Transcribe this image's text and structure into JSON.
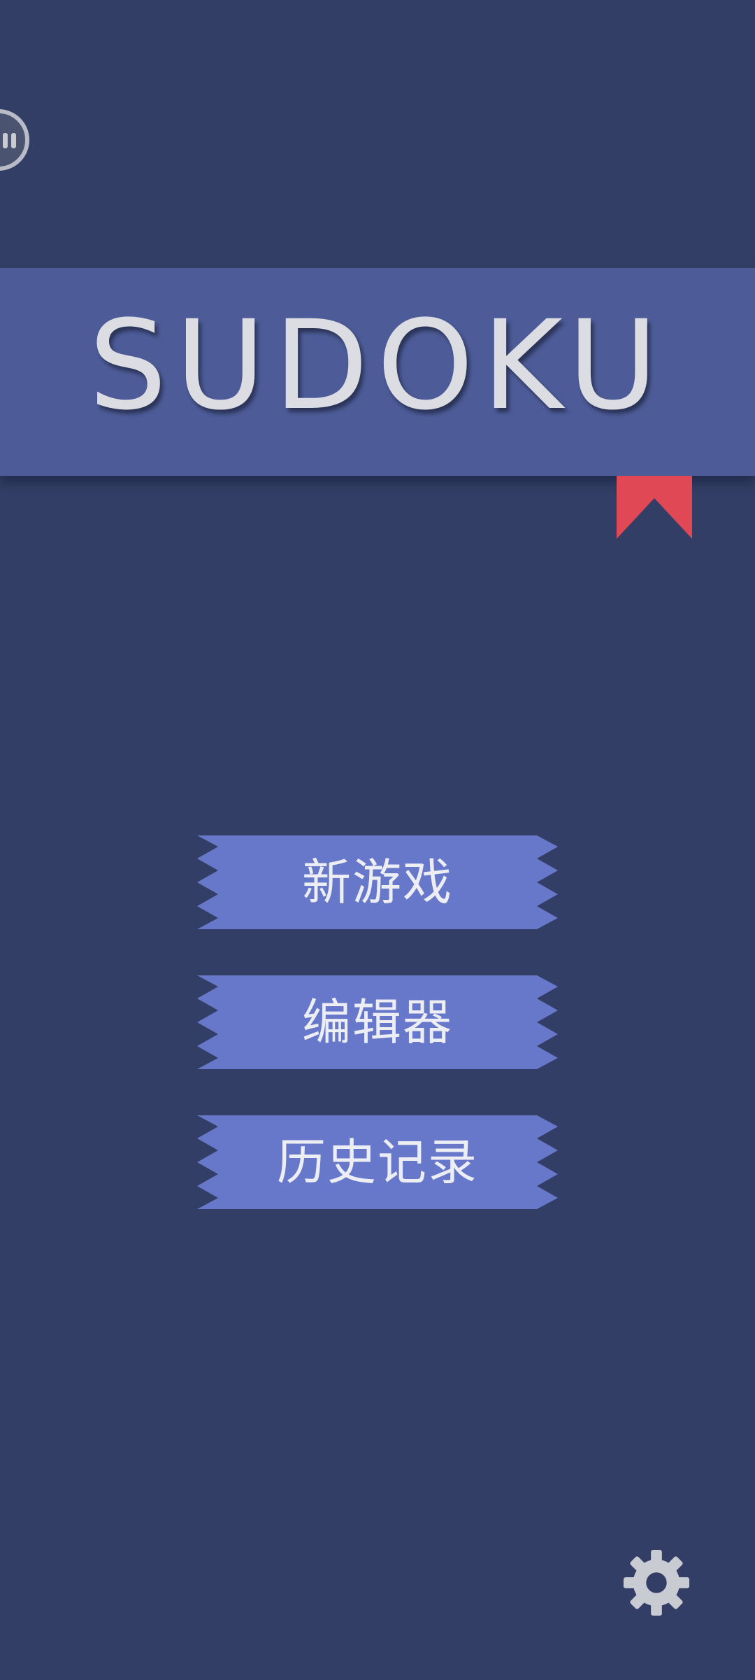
{
  "app": {
    "title": "SUDOKU"
  },
  "menu": {
    "items": [
      {
        "label": "新游戏",
        "icon": "none"
      },
      {
        "label": "编辑器",
        "icon": "none"
      },
      {
        "label": "历史记录",
        "icon": "none"
      }
    ]
  },
  "icons": {
    "floating_handle": "floating-assistant-icon",
    "bookmark": "bookmark-ribbon-icon",
    "settings": "gear-icon"
  },
  "colors": {
    "background": "#323e65",
    "banner": "#4d5c98",
    "ribbon": "#6778cb",
    "bookmark": "#e04856",
    "text_light": "#dcdde2",
    "gear": "#c9cbd3"
  }
}
